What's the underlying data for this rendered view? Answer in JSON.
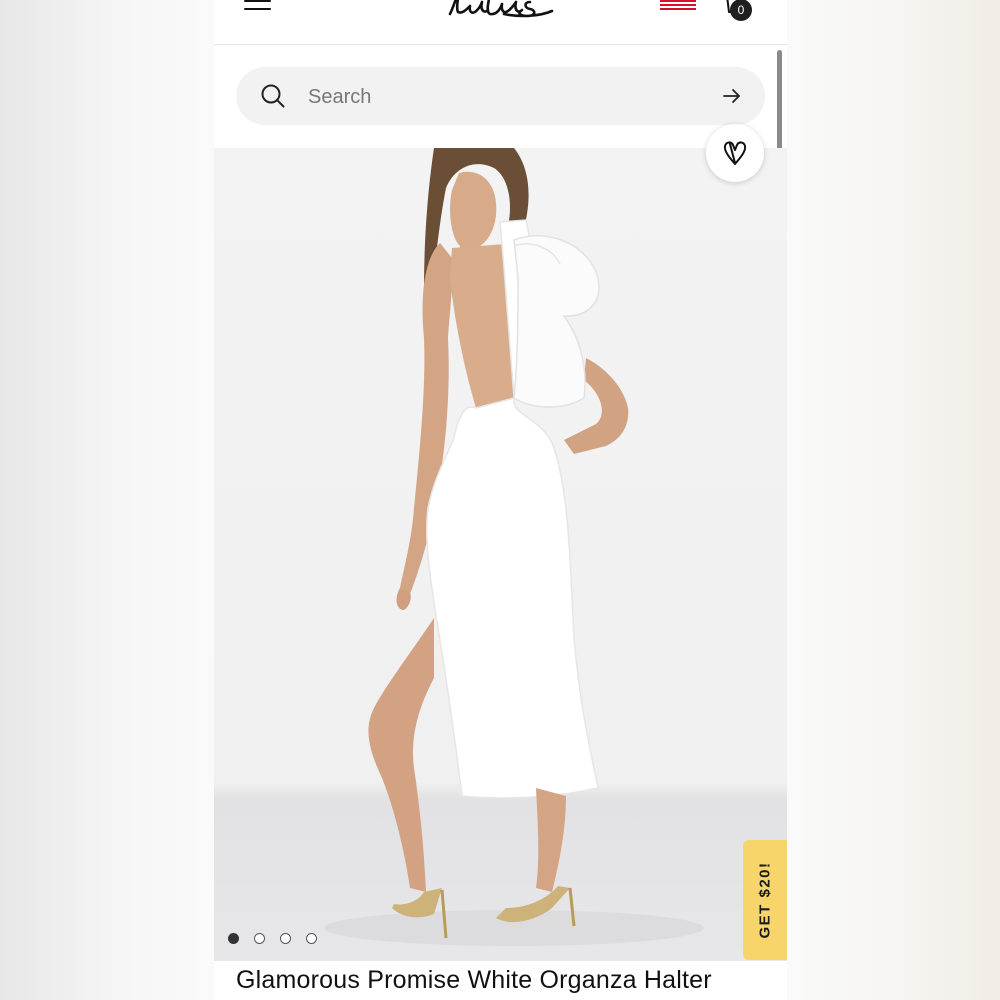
{
  "header": {
    "menu_icon": "hamburger-menu-icon",
    "logo_icon": "lulus-logo",
    "logo_text": "Lulus",
    "flag_icon": "us-flag-icon",
    "cart_icon": "shopping-bag-icon",
    "cart_count": "0"
  },
  "search": {
    "placeholder": "Search",
    "value": "",
    "icon": "search-icon",
    "submit_icon": "arrow-right-icon"
  },
  "product": {
    "wishlist_icon": "heart-icon",
    "carousel": {
      "count": 4,
      "active_index": 0
    },
    "promo_label": "GET $20!",
    "title": "Glamorous Promise White Organza Halter"
  },
  "colors": {
    "promo_bg": "#f7d56b",
    "flag_red": "#d8102e",
    "text": "#111111"
  }
}
